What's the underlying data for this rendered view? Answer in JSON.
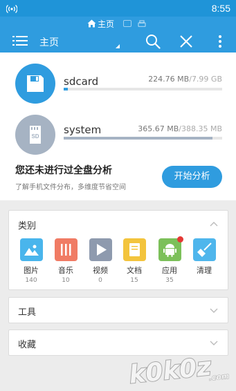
{
  "status_bar": {
    "time": "8:55",
    "signal_icon": "wireless-signal-icon"
  },
  "app_bar": {
    "tab_label": "主页",
    "title": "主页",
    "actions": [
      "menu-icon",
      "search-icon",
      "close-icon",
      "more-vert-icon"
    ]
  },
  "storage": [
    {
      "name": "sdcard",
      "used": "224.76 MB",
      "separator": "/",
      "total": "7.99 GB",
      "fill_fraction": 0.027,
      "color": "#2f9cdf"
    },
    {
      "name": "system",
      "used": "365.67 MB",
      "separator": "/",
      "total": "388.35 MB",
      "fill_fraction": 0.94,
      "color": "#a6b3c3"
    }
  ],
  "analysis": {
    "title": "您还未进行过全盘分析",
    "subtitle": "了解手机文件分布，多维度节省空间",
    "button": "开始分析"
  },
  "categories": {
    "title": "类别",
    "items": [
      {
        "label": "图片",
        "count": "140",
        "icon": "image-icon",
        "color": "#49b5ec"
      },
      {
        "label": "音乐",
        "count": "10",
        "icon": "music-icon",
        "color": "#f07b64"
      },
      {
        "label": "视频",
        "count": "0",
        "icon": "video-icon",
        "color": "#8e9aae"
      },
      {
        "label": "文档",
        "count": "15",
        "icon": "document-icon",
        "color": "#f3c43d"
      },
      {
        "label": "应用",
        "count": "35",
        "icon": "android-icon",
        "color": "#7cc05a"
      },
      {
        "label": "清理",
        "count": "",
        "icon": "broom-icon",
        "color": "#4fb6ec"
      }
    ]
  },
  "tools": {
    "title": "工具"
  },
  "favorites": {
    "title": "收藏"
  },
  "watermark": {
    "text": "k0k0z",
    "suffix": ".com"
  },
  "colors": {
    "primary": "#2f9cdf",
    "status": "#1f94d8",
    "badge": "#e53935"
  }
}
